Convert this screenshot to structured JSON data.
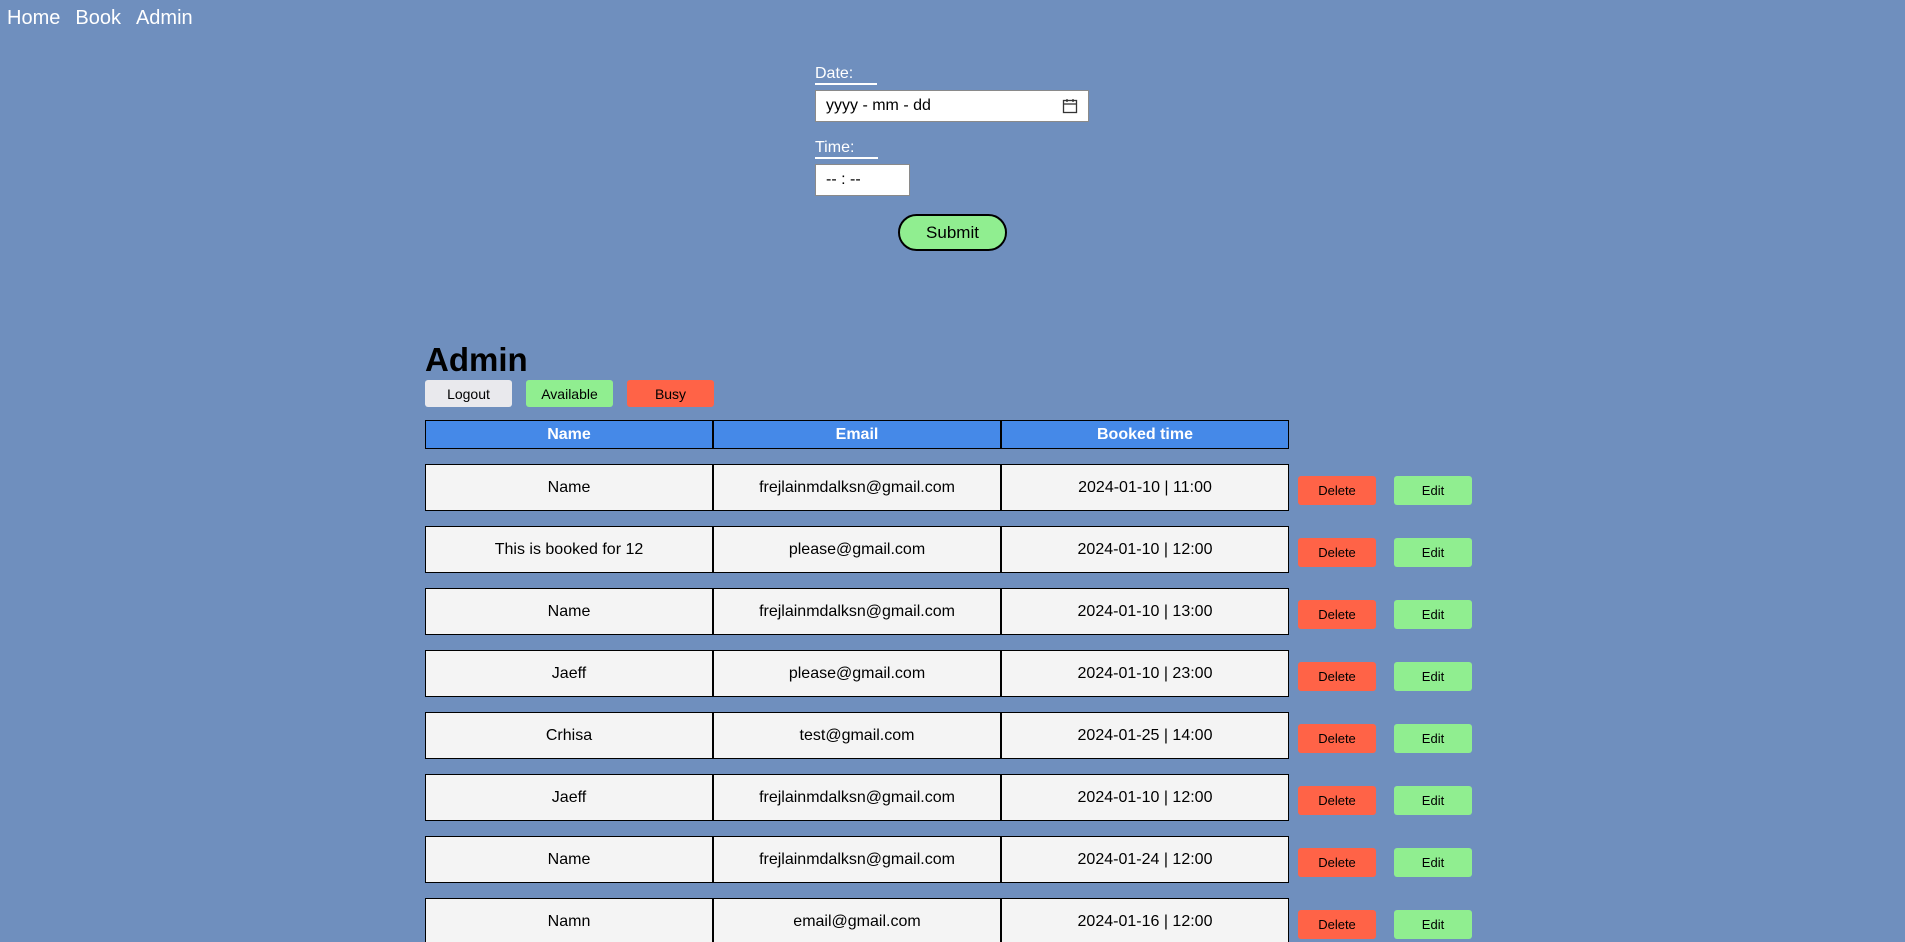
{
  "nav": {
    "items": [
      "Home",
      "Book",
      "Admin"
    ]
  },
  "form": {
    "date_label": "Date:",
    "date_placeholder": "yyyy - mm - dd",
    "time_label": "Time:",
    "time_placeholder": "-- : --",
    "submit_label": "Submit"
  },
  "admin": {
    "title": "Admin",
    "logout_label": "Logout",
    "available_label": "Available",
    "busy_label": "Busy",
    "columns": [
      "Name",
      "Email",
      "Booked time"
    ],
    "delete_label": "Delete",
    "edit_label": "Edit",
    "rows": [
      {
        "name": "Name",
        "email": "frejlainmdalksn@gmail.com",
        "time": "2024-01-10 | 11:00"
      },
      {
        "name": "This is booked for 12",
        "email": "please@gmail.com",
        "time": "2024-01-10 | 12:00"
      },
      {
        "name": "Name",
        "email": "frejlainmdalksn@gmail.com",
        "time": "2024-01-10 | 13:00"
      },
      {
        "name": "Jaeff",
        "email": "please@gmail.com",
        "time": "2024-01-10 | 23:00"
      },
      {
        "name": "Crhisa",
        "email": "test@gmail.com",
        "time": "2024-01-25 | 14:00"
      },
      {
        "name": "Jaeff",
        "email": "frejlainmdalksn@gmail.com",
        "time": "2024-01-10 | 12:00"
      },
      {
        "name": "Name",
        "email": "frejlainmdalksn@gmail.com",
        "time": "2024-01-24 | 12:00"
      },
      {
        "name": "Namn",
        "email": "email@gmail.com",
        "time": "2024-01-16 | 12:00"
      }
    ]
  },
  "colors": {
    "background": "#6f8fbe",
    "header": "#4589e8",
    "green": "#90ee90",
    "red": "#ff6347"
  }
}
